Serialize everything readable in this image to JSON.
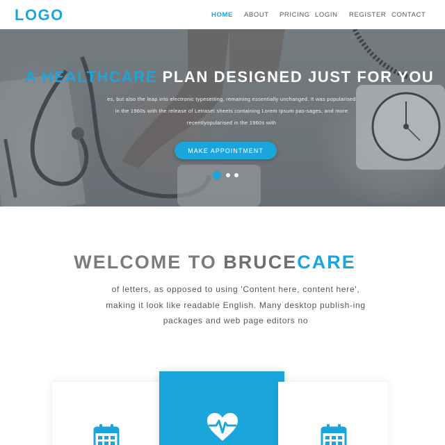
{
  "header": {
    "logo": "LOGO",
    "nav": [
      {
        "label": "HOME",
        "active": true
      },
      {
        "label": "ABOUT",
        "active": false
      },
      {
        "label": "PRICING",
        "active": false
      },
      {
        "label": "LOGIN",
        "active": false
      },
      {
        "label": "REGISTER",
        "active": false
      },
      {
        "label": "CONTACT",
        "active": false
      }
    ]
  },
  "hero": {
    "title_accent": "A HEALTHCARE",
    "title_rest": " PLAN DESIGNED JUST FOR YOU",
    "text": "es, but also the leap into electronic typesetting, remaining essentially unchanged. It was popularised in the 1960s with the release of Letraset sheets containing Lorem Ipsum pas-sages, and more recentlyopularised in the 1960s with",
    "button_label": "MAKE APPOINTMENT",
    "slide_count": 3,
    "active_slide": 1
  },
  "welcome": {
    "title_prefix": "WELCOME TO ",
    "title_brand": "BRUCE",
    "title_brand_accent": "CARE",
    "text": "of letters, as opposed to using 'Content here, content here', making it look like readable English. Many desktop publish-ing packages and web page editors no"
  },
  "cards": [
    {
      "icon": "calendar-icon"
    },
    {
      "icon": "heart-pulse-icon"
    },
    {
      "icon": "calendar-icon"
    }
  ],
  "colors": {
    "accent": "#1aa6db",
    "text_dark": "#555555",
    "heading_gray": "#7b7b7b"
  }
}
